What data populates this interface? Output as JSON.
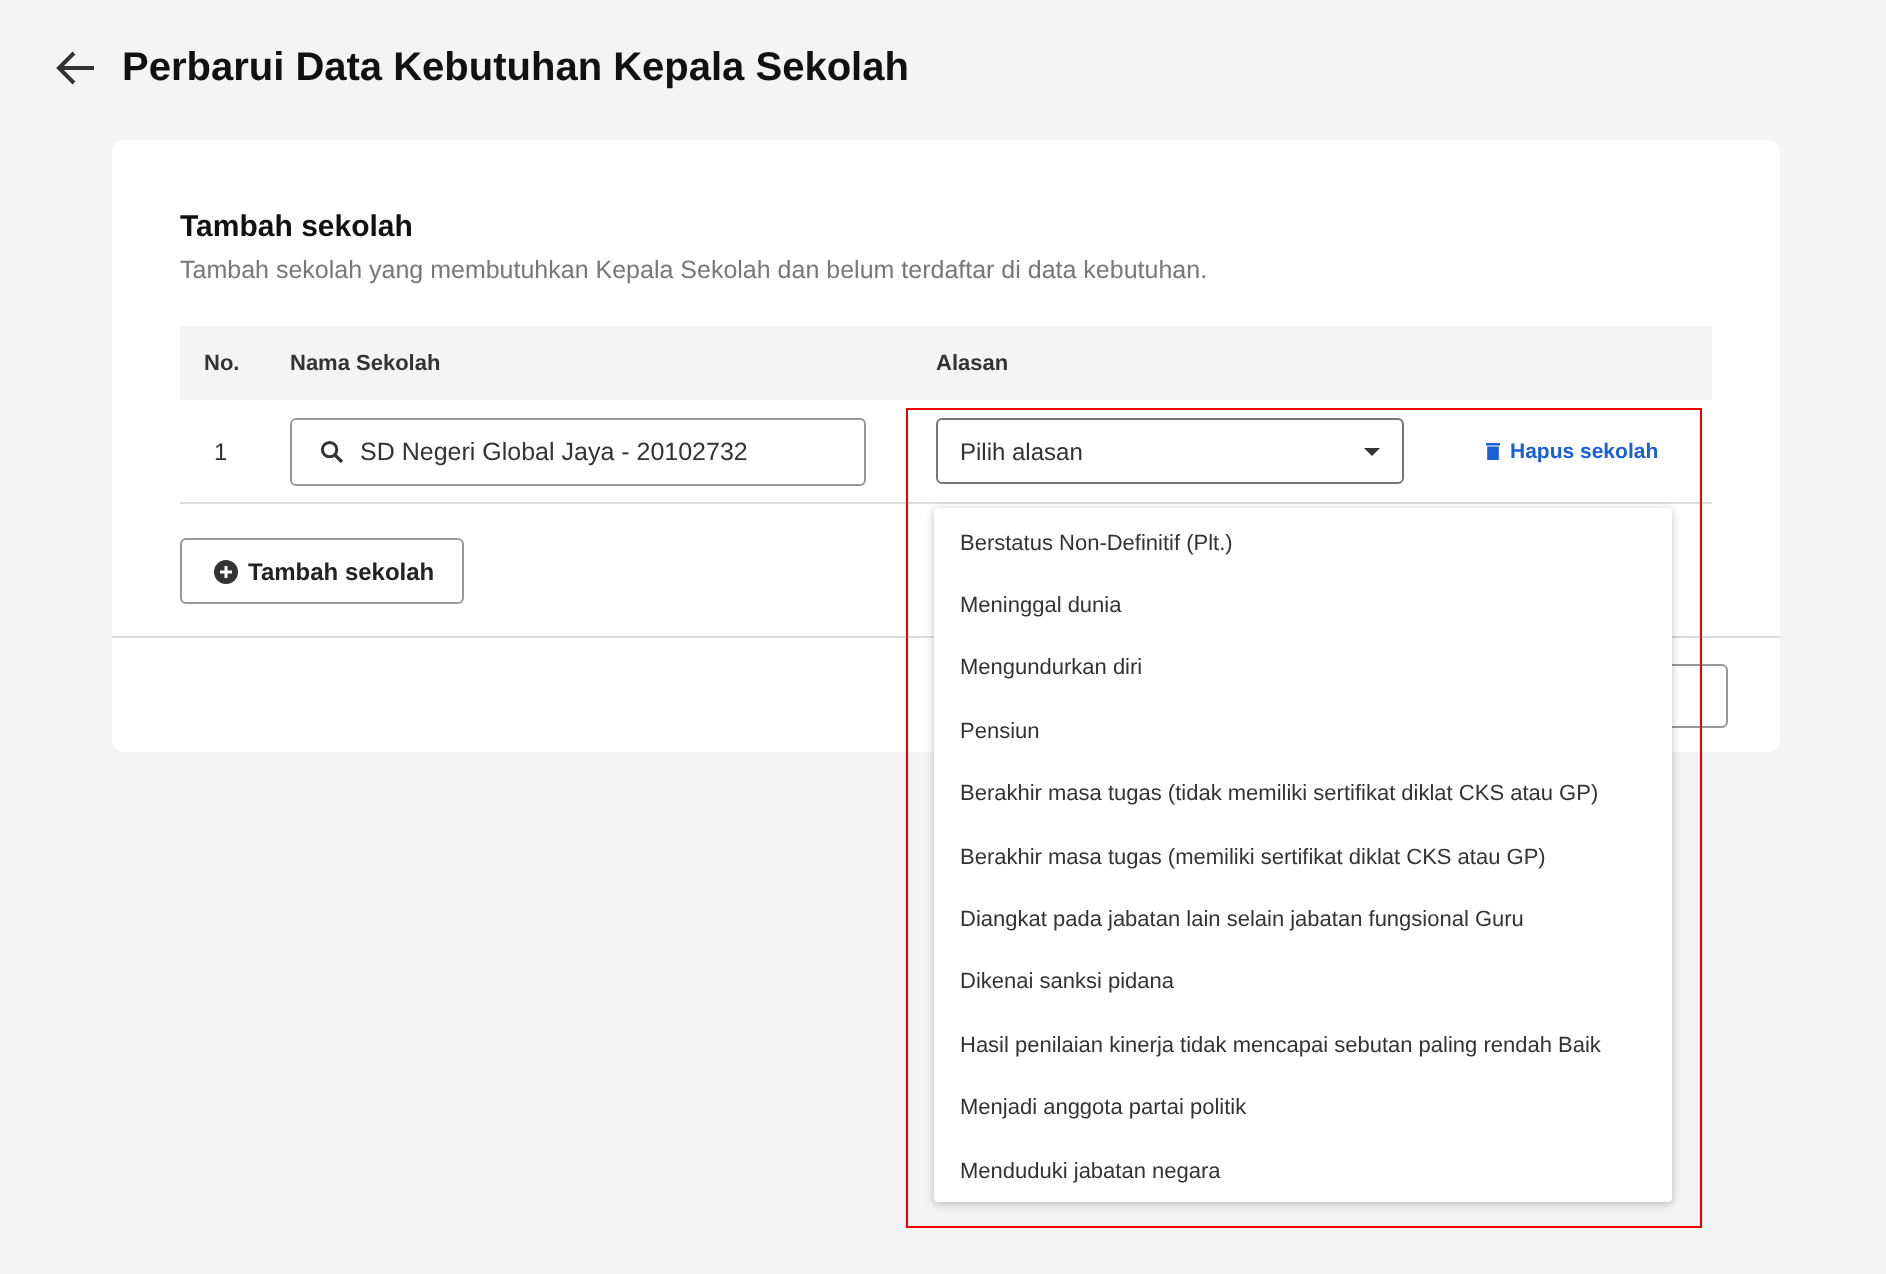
{
  "page": {
    "title": "Perbarui Data Kebutuhan Kepala Sekolah"
  },
  "section": {
    "title": "Tambah sekolah",
    "description": "Tambah sekolah yang membutuhkan Kepala Sekolah dan belum terdaftar di data kebutuhan."
  },
  "table": {
    "columns": [
      "No.",
      "Nama Sekolah",
      "Alasan"
    ],
    "rows": [
      {
        "no": "1",
        "school": "SD Negeri Global Jaya - 20102732",
        "reason_placeholder": "Pilih alasan",
        "delete_label": "Hapus sekolah"
      }
    ]
  },
  "add_button": "Tambah sekolah",
  "dropdown": {
    "expanded": true,
    "options": [
      "Berstatus Non-Definitif (Plt.)",
      "Meninggal dunia",
      "Mengundurkan diri",
      "Pensiun",
      "Berakhir masa tugas (tidak memiliki sertifikat diklat CKS atau GP)",
      "Berakhir masa tugas (memiliki sertifikat diklat CKS atau GP)",
      "Diangkat pada jabatan lain selain jabatan fungsional Guru",
      "Dikenai sanksi pidana",
      "Hasil penilaian kinerja tidak mencapai sebutan paling rendah Baik",
      "Menjadi anggota partai politik",
      "Menduduki jabatan negara"
    ]
  }
}
